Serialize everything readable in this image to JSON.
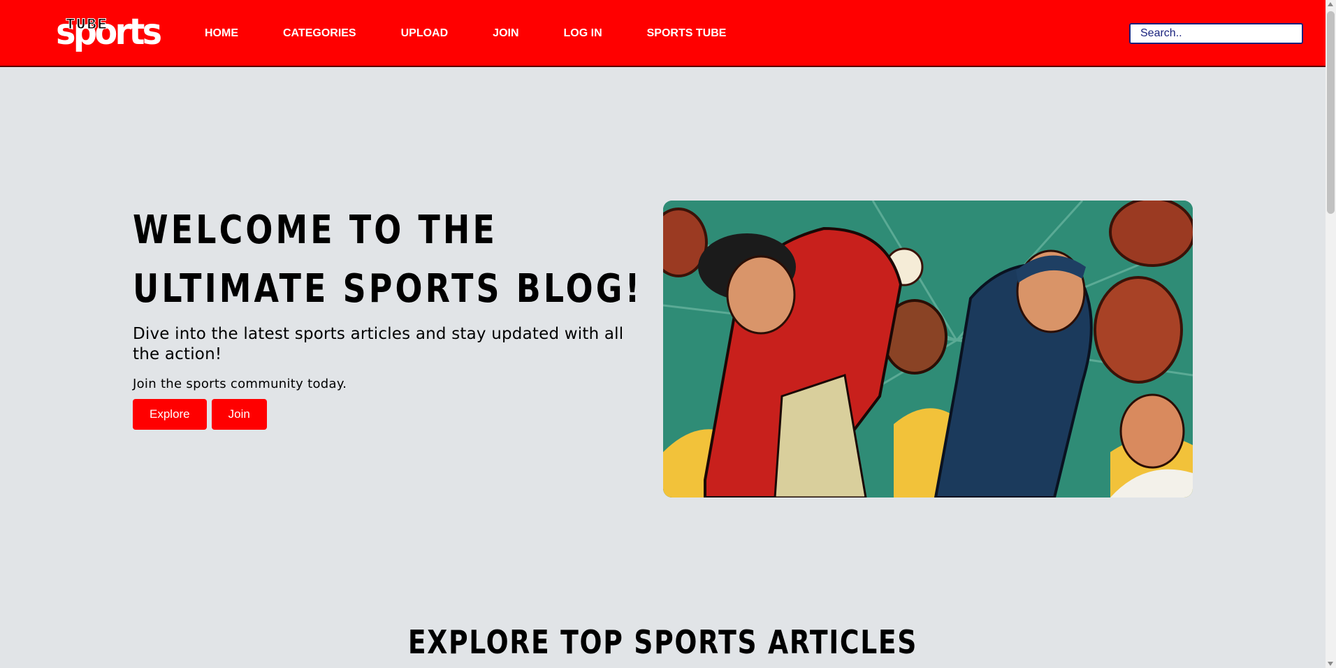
{
  "header": {
    "logo": {
      "main": "sports",
      "overlay": "TUBE"
    },
    "nav": [
      {
        "label": "HOME"
      },
      {
        "label": "CATEGORIES"
      },
      {
        "label": "UPLOAD"
      },
      {
        "label": "JOIN"
      },
      {
        "label": "LOG IN"
      },
      {
        "label": "SPORTS TUBE"
      }
    ],
    "search": {
      "placeholder": "Search.."
    }
  },
  "hero": {
    "title": "Welcome to the Ultimate Sports Blog!",
    "subtitle": "Dive into the latest sports articles and stay updated with all the action!",
    "join_text": "Join the sports community today.",
    "buttons": {
      "explore": "Explore",
      "join": "Join"
    }
  },
  "section": {
    "title": "Explore Top Sports Articles"
  },
  "colors": {
    "brand_red": "#ff0000",
    "page_bg": "#e1e4e7",
    "search_border": "#1a237e"
  },
  "icons": {
    "scroll_up": "arrow-up-icon",
    "scroll_down": "arrow-down-icon"
  }
}
